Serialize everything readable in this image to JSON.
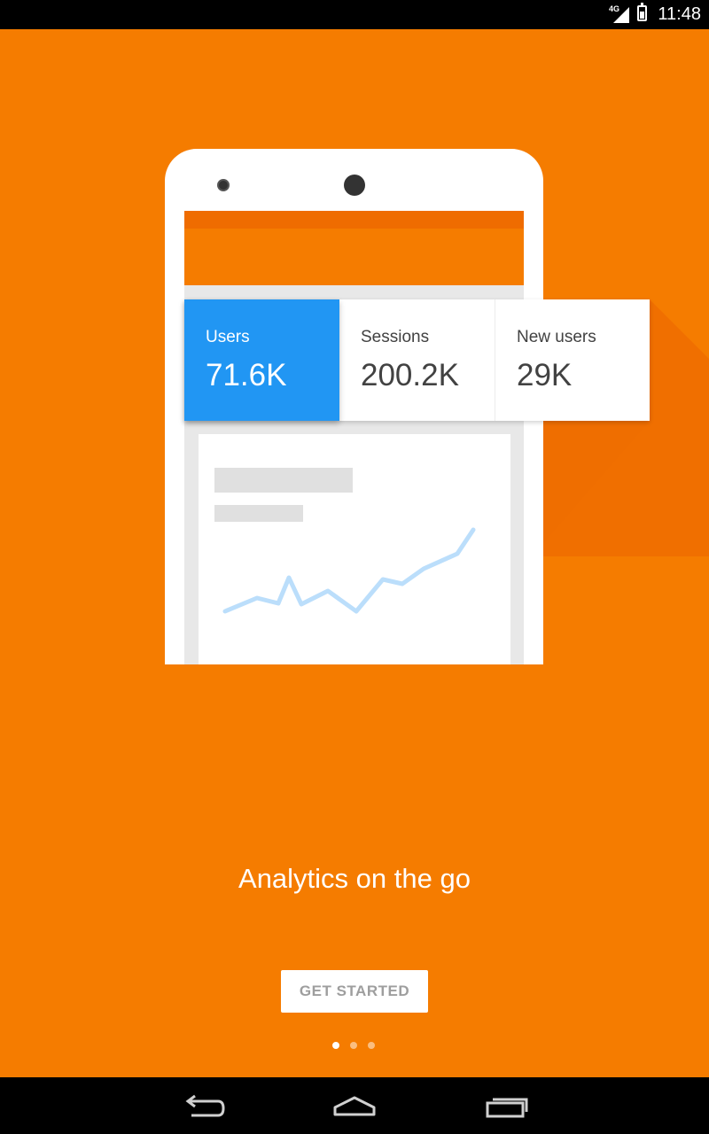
{
  "status_bar": {
    "network": "4G",
    "time": "11:48",
    "icons": [
      "signal-icon",
      "battery-icon"
    ]
  },
  "onboarding": {
    "metrics": [
      {
        "label": "Users",
        "value": "71.6K",
        "selected": true
      },
      {
        "label": "Sessions",
        "value": "200.2K",
        "selected": false
      },
      {
        "label": "New users",
        "value": "29K",
        "selected": false
      }
    ],
    "tagline": "Analytics on the go",
    "cta_label": "GET STARTED",
    "page_indicator": {
      "current": 1,
      "total": 3
    }
  },
  "nav_bar": {
    "icons": [
      "back-icon",
      "home-icon",
      "recents-icon"
    ]
  },
  "colors": {
    "background": "#f57c00",
    "accent_blue": "#2196f3",
    "card": "#ffffff"
  }
}
